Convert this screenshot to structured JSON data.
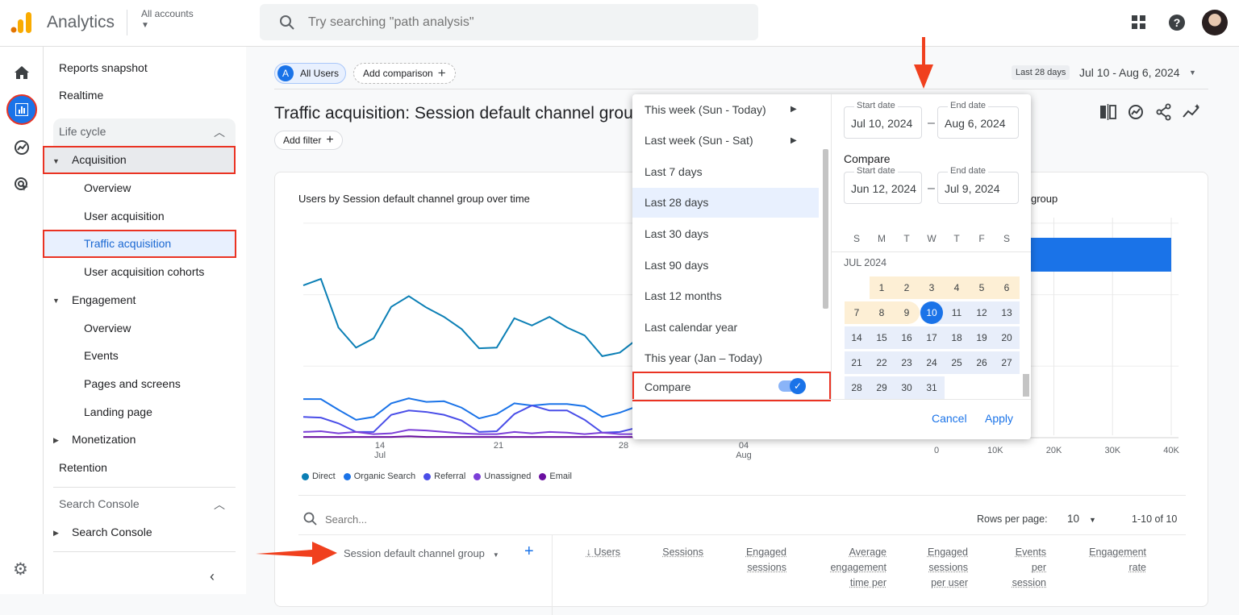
{
  "header": {
    "app_title": "Analytics",
    "account_label": "All accounts",
    "search_placeholder": "Try searching \"path analysis\""
  },
  "rail": {
    "items": [
      "home-icon",
      "reports-icon",
      "explore-icon",
      "advertising-icon",
      "settings-icon"
    ],
    "active": "reports-icon"
  },
  "sidebar": {
    "reports_snapshot": "Reports snapshot",
    "realtime": "Realtime",
    "lifecycle_header": "Life cycle",
    "acquisition": "Acquisition",
    "acquisition_items": [
      "Overview",
      "User acquisition",
      "Traffic acquisition",
      "User acquisition cohorts"
    ],
    "engagement": "Engagement",
    "engagement_items": [
      "Overview",
      "Events",
      "Pages and screens",
      "Landing page"
    ],
    "monetization": "Monetization",
    "retention": "Retention",
    "search_console_header": "Search Console",
    "search_console": "Search Console",
    "selected": "Traffic acquisition"
  },
  "toolbar": {
    "segment_badge": "A",
    "segment_label": "All Users",
    "add_comparison": "Add comparison",
    "date_chip": "Last 28 days",
    "date_range": "Jul 10 - Aug 6, 2024"
  },
  "page": {
    "title": "Traffic acquisition: Session default channel grou",
    "add_filter": "Add filter"
  },
  "datepicker": {
    "presets": [
      {
        "label": "This week (Sun - Today)",
        "submenu": true
      },
      {
        "label": "Last week (Sun - Sat)",
        "submenu": true
      },
      {
        "label": "Last 7 days"
      },
      {
        "label": "Last 28 days",
        "selected": true
      },
      {
        "label": "Last 30 days"
      },
      {
        "label": "Last 90 days"
      },
      {
        "label": "Last 12 months"
      },
      {
        "label": "Last calendar year"
      },
      {
        "label": "This year (Jan – Today)"
      }
    ],
    "compare_label": "Compare",
    "compare_enabled": true,
    "start_label": "Start date",
    "end_label": "End date",
    "start_date": "Jul 10, 2024",
    "end_date": "Aug 6, 2024",
    "compare_heading": "Compare",
    "compare_start": "Jun 12, 2024",
    "compare_end": "Jul 9, 2024",
    "weekdays": [
      "S",
      "M",
      "T",
      "W",
      "T",
      "F",
      "S"
    ],
    "month_label": "JUL 2024",
    "first_weekday_offset": 1,
    "days_in_month": 31,
    "compare_days": [
      1,
      2,
      3,
      4,
      5,
      6,
      7,
      8,
      9
    ],
    "selected_start": 10,
    "cancel": "Cancel",
    "apply": "Apply",
    "colors": {
      "range": "#e8eefa",
      "compare": "#fdefd5",
      "selected": "#1a73e8"
    }
  },
  "chart_data": [
    {
      "type": "line",
      "title": "Users by Session default channel group over time",
      "x": [
        "Jul 10",
        "Jul 11",
        "Jul 12",
        "Jul 13",
        "Jul 14",
        "Jul 15",
        "Jul 16",
        "Jul 17",
        "Jul 18",
        "Jul 19",
        "Jul 20",
        "Jul 21",
        "Jul 22",
        "Jul 23",
        "Jul 24",
        "Jul 25",
        "Jul 26",
        "Jul 27",
        "Jul 28",
        "Jul 29"
      ],
      "x_ticks": [
        {
          "label": "14",
          "sub": "Jul"
        },
        {
          "label": "21",
          "sub": ""
        },
        {
          "label": "28",
          "sub": ""
        },
        {
          "label": "04",
          "sub": "Aug"
        }
      ],
      "grid": true,
      "series": [
        {
          "name": "Direct",
          "color": "#0b7fb5",
          "values": [
            2.13,
            2.22,
            1.54,
            1.26,
            1.39,
            1.83,
            1.98,
            1.82,
            1.69,
            1.52,
            1.25,
            1.26,
            1.67,
            1.57,
            1.69,
            1.54,
            1.43,
            1.14,
            1.19,
            1.38
          ]
        },
        {
          "name": "Organic Search",
          "color": "#1a73e8",
          "values": [
            0.54,
            0.54,
            0.39,
            0.25,
            0.29,
            0.48,
            0.55,
            0.5,
            0.51,
            0.42,
            0.27,
            0.33,
            0.48,
            0.45,
            0.47,
            0.47,
            0.44,
            0.29,
            0.35,
            0.44
          ]
        },
        {
          "name": "Referral",
          "color": "#4a4ee8",
          "values": [
            0.29,
            0.28,
            0.2,
            0.08,
            0.08,
            0.32,
            0.38,
            0.36,
            0.32,
            0.24,
            0.08,
            0.09,
            0.33,
            0.45,
            0.38,
            0.38,
            0.25,
            0.07,
            0.08,
            0.14
          ]
        },
        {
          "name": "Unassigned",
          "color": "#7b3fd8",
          "values": [
            0.08,
            0.09,
            0.06,
            0.08,
            0.05,
            0.06,
            0.11,
            0.1,
            0.08,
            0.06,
            0.05,
            0.05,
            0.08,
            0.06,
            0.08,
            0.07,
            0.05,
            0.07,
            0.05,
            0.05
          ]
        },
        {
          "name": "Email",
          "color": "#6a0fa0",
          "values": [
            0.01,
            0.01,
            0.01,
            0.01,
            0.01,
            0.01,
            0.02,
            0.01,
            0.01,
            0.01,
            0.01,
            0.01,
            0.01,
            0.01,
            0.01,
            0.01,
            0.01,
            0.01,
            0.01,
            0.01
          ]
        }
      ]
    },
    {
      "type": "bar",
      "title_visible_part": "group",
      "orientation": "horizontal",
      "x_ticks": [
        "0",
        "10K",
        "20K",
        "30K",
        "40K"
      ],
      "xlim": [
        0,
        40000
      ],
      "values": [
        40000
      ],
      "color": "#1a73e8",
      "grid": true
    }
  ],
  "table": {
    "search_placeholder": "Search...",
    "rows_per_page_label": "Rows per page:",
    "rows_per_page": "10",
    "pagination": "1-10 of 10",
    "dimension_header": "Session default channel group",
    "sort_icon": "arrow-down-icon",
    "columns": [
      "Users",
      "Sessions",
      "Engaged\nsessions",
      "Average\nengagement\ntime per",
      "Engaged\nsessions\nper user",
      "Events\nper\nsession",
      "Engagement\nrate"
    ]
  }
}
